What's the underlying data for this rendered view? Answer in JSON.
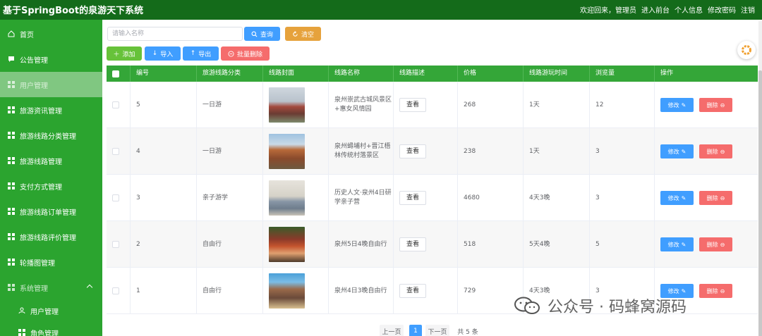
{
  "app": {
    "title": "基于SpringBoot的泉游天下系统",
    "nav": [
      "欢迎回来，管理员",
      "进入前台",
      "个人信息",
      "修改密码",
      "注销"
    ]
  },
  "sidebar": {
    "items": [
      {
        "label": "首页",
        "icon": "home-icon"
      },
      {
        "label": "公告管理",
        "icon": "chat-icon"
      },
      {
        "label": "用户管理",
        "icon": "grid-icon",
        "active": true
      },
      {
        "label": "旅游资讯管理",
        "icon": "grid-icon"
      },
      {
        "label": "旅游线路分类管理",
        "icon": "grid-icon"
      },
      {
        "label": "旅游线路管理",
        "icon": "grid-icon"
      },
      {
        "label": "支付方式管理",
        "icon": "grid-icon"
      },
      {
        "label": "旅游线路订单管理",
        "icon": "grid-icon"
      },
      {
        "label": "旅游线路评价管理",
        "icon": "grid-icon"
      },
      {
        "label": "轮播图管理",
        "icon": "grid-icon"
      },
      {
        "label": "系统管理",
        "icon": "grid-icon",
        "expanded": true
      },
      {
        "label": "用户管理",
        "icon": "user-icon",
        "sub": true
      },
      {
        "label": "角色管理",
        "icon": "grid-icon",
        "sub": true
      }
    ]
  },
  "search": {
    "placeholder": "请输入名称",
    "value": ""
  },
  "toolbar": {
    "query": "查询",
    "clear": "清空",
    "add": "添加",
    "import": "导入",
    "export": "导出",
    "bulk_delete": "批量删除"
  },
  "table": {
    "columns": [
      "编号",
      "旅游线路分类",
      "线路封面",
      "线路名称",
      "线路描述",
      "价格",
      "线路游玩时间",
      "浏览量",
      "操作"
    ],
    "view_label": "查看",
    "edit_label": "修改",
    "delete_label": "删除",
    "rows": [
      {
        "id": "5",
        "category": "一日游",
        "name": "泉州崇武古城风景区+惠女风情园",
        "price": "268",
        "duration": "1天",
        "views": "12"
      },
      {
        "id": "4",
        "category": "一日游",
        "name": "泉州蟳埔村+晋江梧林传统村落景区",
        "price": "238",
        "duration": "1天",
        "views": "3"
      },
      {
        "id": "3",
        "category": "亲子游学",
        "name": "历史人文·泉州4日研学亲子营",
        "price": "4680",
        "duration": "4天3晚",
        "views": "3"
      },
      {
        "id": "2",
        "category": "自由行",
        "name": "泉州5日4晚自由行",
        "price": "518",
        "duration": "5天4晚",
        "views": "5"
      },
      {
        "id": "1",
        "category": "自由行",
        "name": "泉州4日3晚自由行",
        "price": "729",
        "duration": "4天3晚",
        "views": "3"
      }
    ]
  },
  "pagination": {
    "prev": "上一页",
    "current": "1",
    "next": "下一页",
    "total": "共 5 条"
  },
  "watermark": {
    "text": "公众号 · 码蜂窝源码"
  },
  "colors": {
    "header": "#146b1a",
    "sidebar": "#2ba42f",
    "thead": "#34a638",
    "primary": "#409eff",
    "danger": "#f56c6c",
    "warning": "#e6a23c",
    "success": "#67c23a"
  }
}
